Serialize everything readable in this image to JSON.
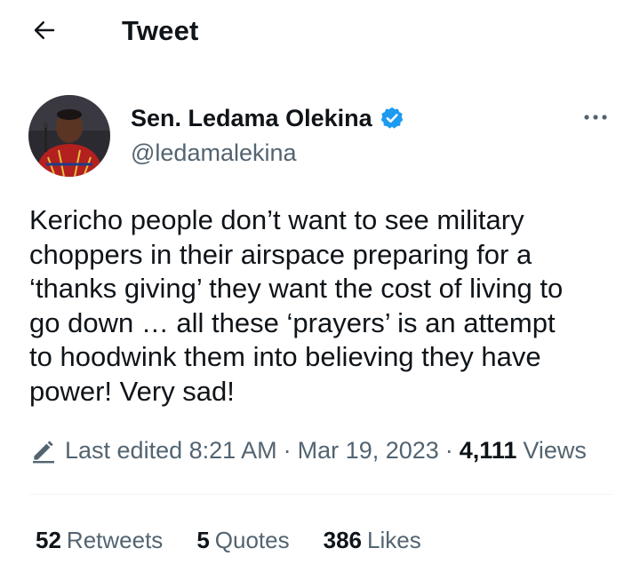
{
  "header": {
    "title": "Tweet",
    "back_icon": "arrow-left-icon"
  },
  "author": {
    "display_name": "Sen. Ledama Olekina",
    "handle": "@ledamalekina",
    "verified_icon": "verified-badge-icon",
    "verified_color": "#1d9bf0"
  },
  "more_icon": "more-horizontal-icon",
  "tweet": {
    "text": "Kericho people don’t want to see military\nchoppers in their airspace preparing for a\n‘thanks giving’ they want the cost of living to\ngo down … all these ‘prayers’ is an attempt\nto hoodwink them into believing they have\npower! Very sad!"
  },
  "meta": {
    "edit_icon": "pencil-edit-icon",
    "edited_label": "Last edited 8:21 AM",
    "separator": "·",
    "date": "Mar 19, 2023",
    "views_count": "4,111",
    "views_label": "Views"
  },
  "stats": {
    "retweets_count": "52",
    "retweets_label": "Retweets",
    "quotes_count": "5",
    "quotes_label": "Quotes",
    "likes_count": "386",
    "likes_label": "Likes"
  },
  "colors": {
    "text_primary": "#0f1419",
    "text_secondary": "#536471",
    "accent": "#1d9bf0",
    "divider": "#eff3f4"
  }
}
